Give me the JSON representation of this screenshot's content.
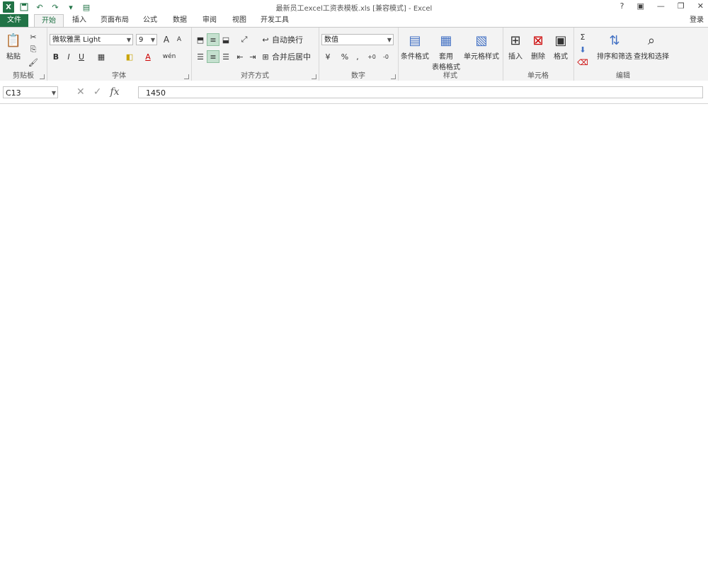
{
  "window": {
    "title": "最新员工excel工资表模板.xls  [兼容模式] - Excel",
    "login": "登录"
  },
  "tabs": [
    "文件",
    "开始",
    "插入",
    "页面布局",
    "公式",
    "数据",
    "审阅",
    "视图",
    "开发工具"
  ],
  "ribbon": {
    "clipboard": {
      "paste": "粘贴",
      "label": "剪贴板"
    },
    "font": {
      "name": "微软雅黑 Light",
      "size": "9",
      "bold": "B",
      "italic": "I",
      "underline": "U",
      "grow": "A",
      "shrink": "A",
      "label": "字体",
      "wen": "wén"
    },
    "alignment": {
      "wrap": "自动换行",
      "merge": "合并后居中",
      "label": "对齐方式"
    },
    "number": {
      "format": "数值",
      "currency": "¥",
      "percent": "%",
      "comma": ",",
      "inc": "+0",
      "dec": "-0",
      "label": "数字"
    },
    "styles": {
      "conditional": "条件格式",
      "table_fmt_1": "套用",
      "table_fmt_2": "表格格式",
      "cell_style": "单元格样式",
      "label": "样式"
    },
    "cells": {
      "insert": "插入",
      "delete": "删除",
      "format": "格式",
      "label": "单元格"
    },
    "editing": {
      "sort": "排序和筛选",
      "find": "查找和选择",
      "label": "编辑"
    }
  },
  "formula_bar": {
    "name_box": "C13",
    "value": "1450",
    "fx": "fx"
  }
}
